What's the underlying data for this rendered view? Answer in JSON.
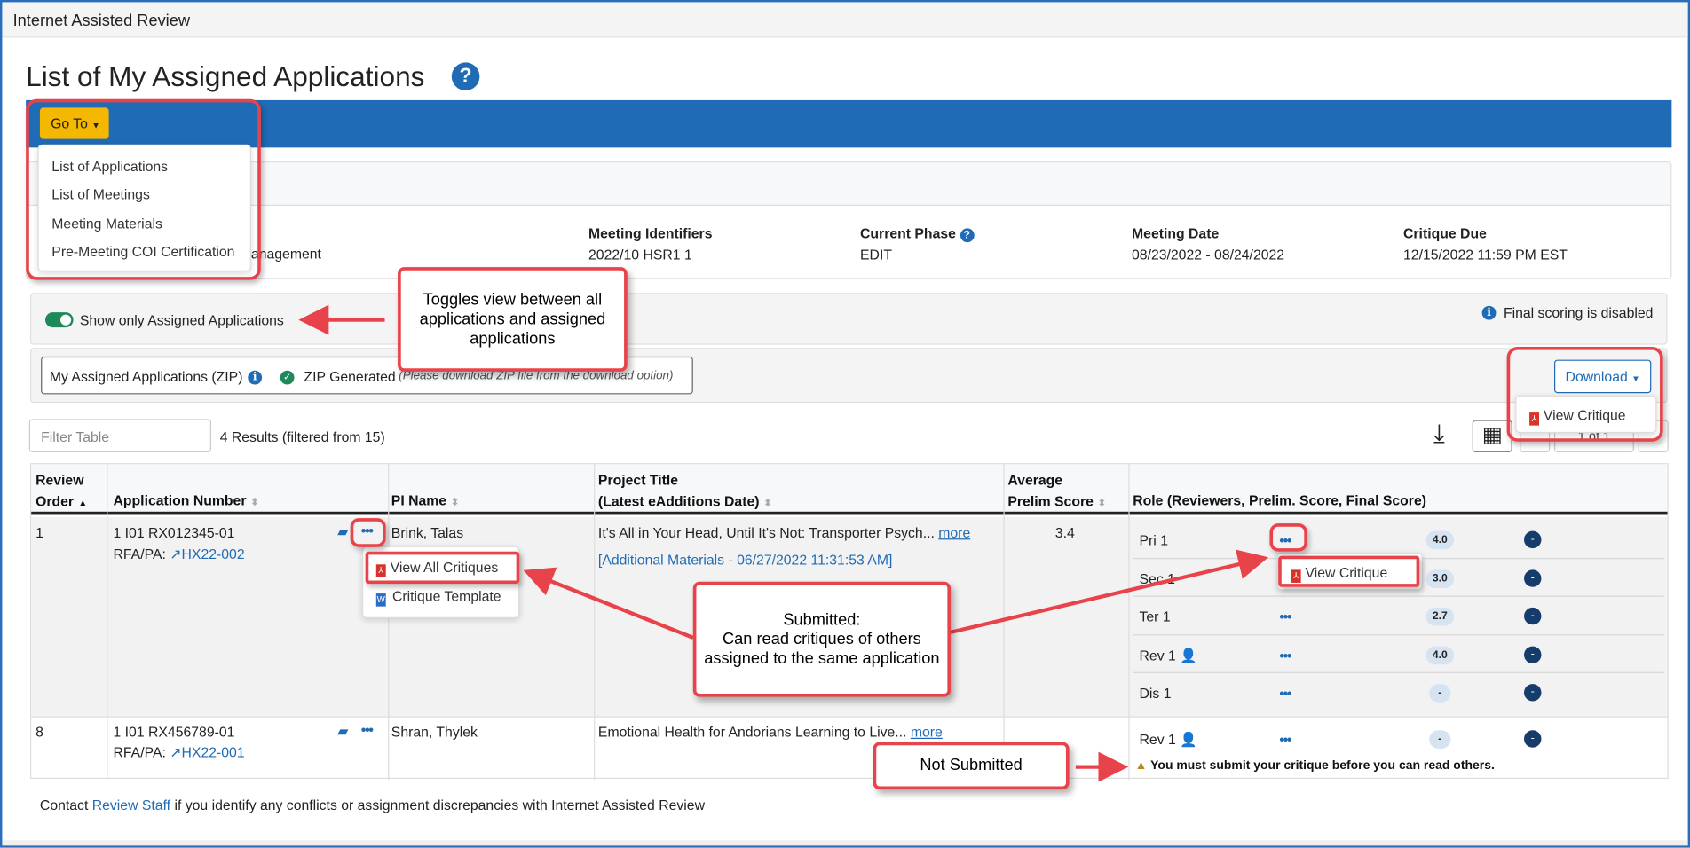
{
  "window": {
    "title": "Internet Assisted Review"
  },
  "page": {
    "title": "List of My Assigned Applications",
    "help_icon": "question-circle-icon"
  },
  "goto": {
    "label": "Go To",
    "items": [
      "List of Applications",
      "List of Meetings",
      "Meeting Materials",
      "Pre-Meeting COI Certification"
    ]
  },
  "meeting_info": {
    "partial_text": "anagement",
    "fields": [
      {
        "label": "Meeting Identifiers",
        "value": "2022/10 HSR1 1"
      },
      {
        "label": "Current Phase",
        "value": "EDIT"
      },
      {
        "label": "Meeting Date",
        "value": "08/23/2022 - 08/24/2022"
      },
      {
        "label": "Critique Due",
        "value": "12/15/2022 11:59 PM EST"
      }
    ]
  },
  "toggle": {
    "label": "Show only Assigned Applications",
    "on": true
  },
  "final_scoring": "Final scoring is disabled",
  "zip": {
    "label": "My Assigned Applications (ZIP)",
    "status": "ZIP Generated",
    "note": "(Please download ZIP file from the download option)"
  },
  "download": {
    "label": "Download",
    "menu_item": "View Critique"
  },
  "filter": {
    "placeholder": "Filter Table",
    "results": "4 Results (filtered from 15)"
  },
  "pagination": {
    "text": "1 of 1"
  },
  "table": {
    "headers": {
      "review_order": [
        "Review",
        "Order"
      ],
      "application_number": "Application Number",
      "pi_name": "PI Name",
      "project_title": [
        "Project Title",
        "(Latest eAdditions Date)"
      ],
      "avg_score": [
        "Average",
        "Prelim Score"
      ],
      "role": "Role (Reviewers, Prelim. Score, Final Score)"
    },
    "rows": [
      {
        "order": "1",
        "app_number": "1 I01 RX012345-01",
        "rfa_label": "RFA/PA:",
        "rfa": "HX22-002",
        "pi": "Brink, Talas",
        "title": "It's All in Your Head, Until It's Not: Transporter Psych...",
        "more": "more",
        "additional": "[Additional Materials - 06/27/2022 11:31:53 AM]",
        "avg": "3.4",
        "actions_menu": [
          "View All Critiques",
          "Critique Template"
        ],
        "roles": [
          {
            "role": "Pri 1",
            "prelim": "4.0",
            "final": "-",
            "is_me": false
          },
          {
            "role": "Sec 1",
            "prelim": "3.0",
            "final": "-",
            "is_me": false
          },
          {
            "role": "Ter 1",
            "prelim": "2.7",
            "final": "-",
            "is_me": false
          },
          {
            "role": "Rev 1",
            "prelim": "4.0",
            "final": "-",
            "is_me": true
          },
          {
            "role": "Dis 1",
            "prelim": "-",
            "final": "-",
            "is_me": false
          }
        ],
        "role_menu": "View Critique"
      },
      {
        "order": "8",
        "app_number": "1 I01 RX456789-01",
        "rfa_label": "RFA/PA:",
        "rfa": "HX22-001",
        "pi": "Shran, Thylek",
        "title": "Emotional Health for Andorians Learning to Live...",
        "more": "more",
        "avg": "",
        "roles": [
          {
            "role": "Rev 1",
            "prelim": "-",
            "final": "-",
            "is_me": true
          }
        ],
        "warning": "You must submit your critique before you can read others."
      }
    ]
  },
  "footer": {
    "prefix": "Contact ",
    "link": "Review Staff",
    "suffix": " if you identify any conflicts or assignment discrepancies with Internet Assisted Review"
  },
  "annotations": {
    "toggle": "Toggles view between all applications and assigned applications",
    "submitted": [
      "Submitted:",
      "Can read critiques of others assigned to the same application"
    ],
    "not_submitted": "Not Submitted"
  },
  "colors": {
    "brand_blue": "#1f6bb5",
    "goto_yellow": "#f5b800",
    "annotation_red": "#e8434a",
    "toggle_green": "#1e8a5a",
    "final_score_dark": "#163c6b"
  }
}
